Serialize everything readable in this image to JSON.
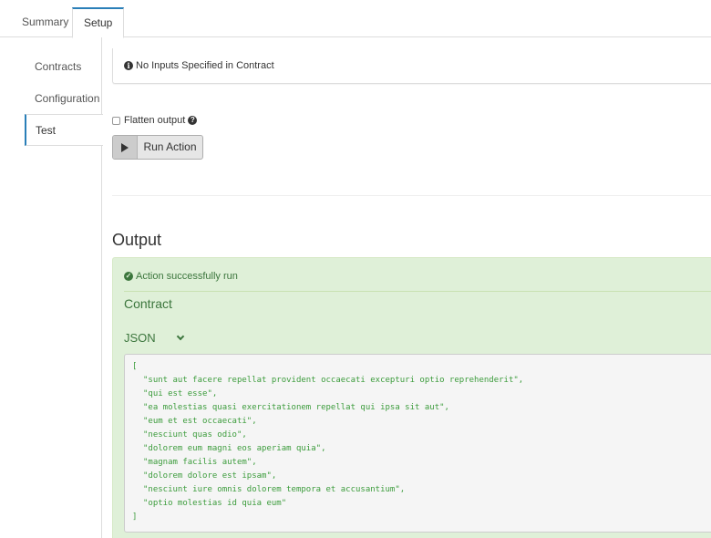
{
  "tabs": [
    {
      "label": "Summary"
    },
    {
      "label": "Setup"
    }
  ],
  "sidebar": {
    "items": [
      {
        "label": "Contracts"
      },
      {
        "label": "Configuration"
      },
      {
        "label": "Test"
      }
    ]
  },
  "inputs": {
    "message": "No Inputs Specified in Contract"
  },
  "options": {
    "flatten_label": "Flatten output",
    "flatten_checked": false
  },
  "run_button": {
    "label": "Run Action"
  },
  "output": {
    "title": "Output",
    "status": "Action successfully run",
    "contract_label": "Contract",
    "format_label": "JSON",
    "json_open": "[",
    "json_lines": [
      "\"sunt aut facere repellat provident occaecati excepturi optio reprehenderit\",",
      "\"qui est esse\",",
      "\"ea molestias quasi exercitationem repellat qui ipsa sit aut\",",
      "\"eum et est occaecati\",",
      "\"nesciunt quas odio\",",
      "\"dolorem eum magni eos aperiam quia\",",
      "\"magnam facilis autem\",",
      "\"dolorem dolore est ipsam\",",
      "\"nesciunt iure omnis dolorem tempora et accusantium\",",
      "\"optio molestias id quia eum\""
    ],
    "json_close": "]"
  },
  "colors": {
    "accent": "#2a7fb8",
    "success_bg": "#dff0d8",
    "success_text": "#3c763d"
  }
}
